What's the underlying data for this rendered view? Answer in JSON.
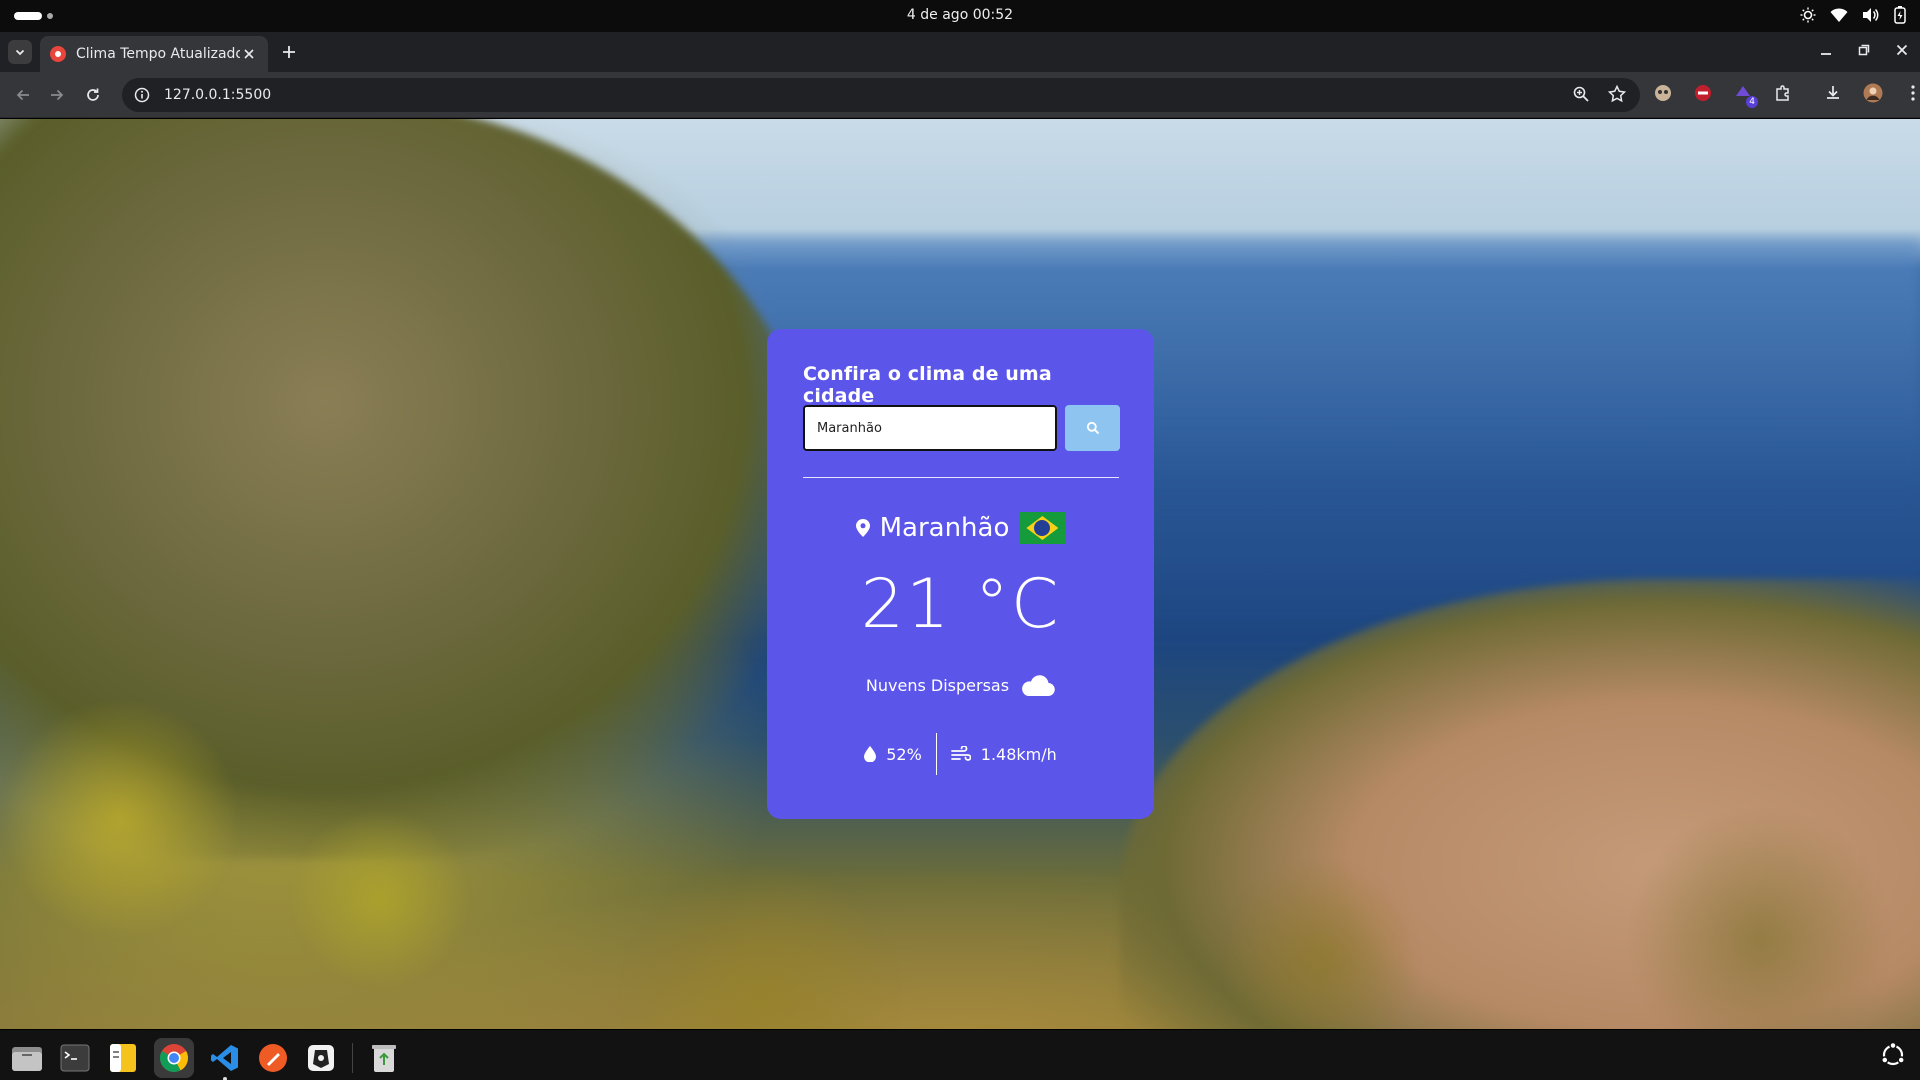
{
  "system": {
    "clock": "4 de ago  00:52"
  },
  "browser": {
    "tab_title": "Clima Tempo Atualizado",
    "url": "127.0.0.1:5500",
    "extension_badge": "4"
  },
  "weather": {
    "heading": "Confira o clima de uma cidade",
    "search_value": "Maranhão",
    "city": "Maranhão",
    "temperature": "21 °C",
    "description": "Nuvens Dispersas",
    "humidity": "52%",
    "wind": "1.48km/h",
    "colors": {
      "card": "#5b55ea",
      "search_button": "#8ec5f0"
    }
  },
  "dock": {
    "apps": [
      "files-icon",
      "terminal-icon",
      "notes-icon",
      "chrome-icon",
      "vscode-icon",
      "postman-icon",
      "inkscape-icon",
      "trash-icon"
    ]
  }
}
